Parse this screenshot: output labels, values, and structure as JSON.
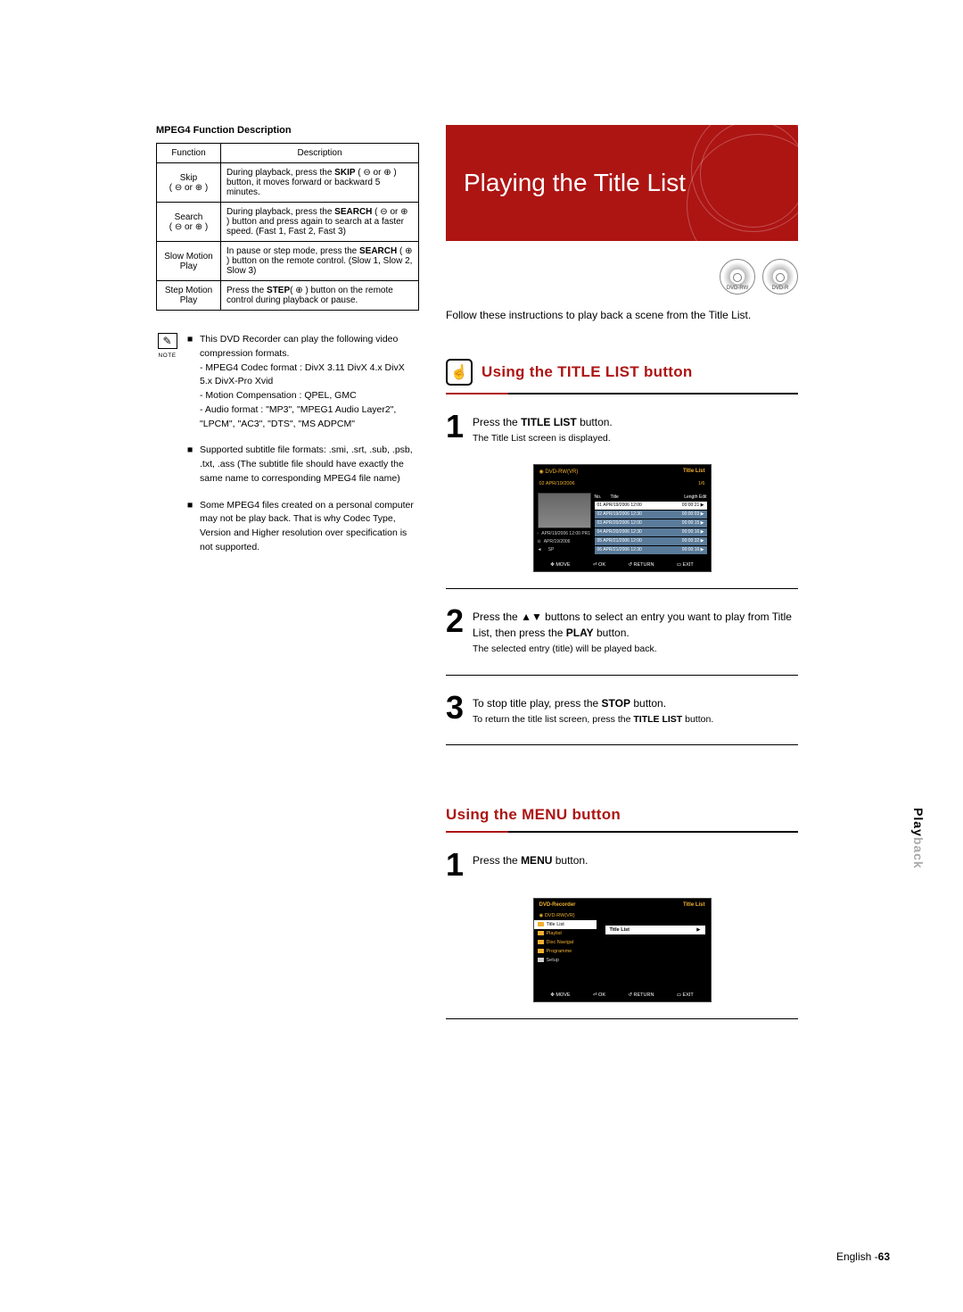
{
  "left": {
    "table_title": "MPEG4 Function Description",
    "headers": [
      "Function",
      "Description"
    ],
    "rows": [
      {
        "func": "Skip\n( ⊖ or ⊕ )",
        "desc_pre": "During playback, press the ",
        "desc_bold": "SKIP",
        "desc_post": " ( ⊖ or ⊕ ) button, it moves forward or backward 5 minutes."
      },
      {
        "func": "Search\n( ⊖ or ⊕ )",
        "desc_pre": "During playback, press the ",
        "desc_bold": "SEARCH",
        "desc_post": " ( ⊖ or ⊕ ) button and press again to search at a faster speed. (Fast 1, Fast 2, Fast 3)"
      },
      {
        "func": "Slow Motion\nPlay",
        "desc_pre": "In pause or step mode, press the ",
        "desc_bold": "SEARCH",
        "desc_post": " ( ⊕ ) button on the remote control. (Slow 1, Slow 2, Slow 3)"
      },
      {
        "func": "Step Motion\nPlay",
        "desc_pre": "Press the ",
        "desc_bold": "STEP",
        "desc_post": "( ⊕ ) button on the remote control during playback or pause."
      }
    ],
    "note_label": "NOTE",
    "notes": [
      {
        "text": "This DVD Recorder can play the following video compression formats.",
        "sub": [
          "MPEG4 Codec format : DivX 3.11 DivX 4.x DivX 5.x DivX-Pro Xvid",
          "Motion Compensation : QPEL, GMC",
          "Audio format : \"MP3\", \"MPEG1 Audio Layer2\", \"LPCM\", \"AC3\", \"DTS\", \"MS ADPCM\""
        ]
      },
      {
        "text": "Supported subtitle file formats: .smi, .srt, .sub, .psb, .txt, .ass (The subtitle file should have exactly the same name to corresponding MPEG4 file name)"
      },
      {
        "text": "Some MPEG4 files created on a personal computer may not be play back. That is why Codec Type, Version and Higher resolution over specification is not supported."
      }
    ]
  },
  "right": {
    "hero": "Playing the Title List",
    "discs": [
      "DVD-RW",
      "DVD-R"
    ],
    "intro": "Follow these instructions to play back a scene from the Title List.",
    "section1_title": "Using the TITLE LIST button",
    "step1_main_pre": "Press the ",
    "step1_main_bold": "TITLE LIST",
    "step1_main_post": " button.",
    "step1_sub": "The Title List screen is displayed.",
    "osd1": {
      "header_left": "DVD-RW(VR)",
      "header_right": "Title List",
      "subhead_left": "02 APR/19/2006",
      "subhead_right": "1/6",
      "list_head": [
        "No.",
        "Title",
        "Length Edit"
      ],
      "rows": [
        {
          "n": "01",
          "t": "APR/19/2006 12:00",
          "l": "00:00:21 ▶"
        },
        {
          "n": "02",
          "t": "APR/19/2006 12:30",
          "l": "00:00:03 ▶"
        },
        {
          "n": "03",
          "t": "APR/20/2006 12:00",
          "l": "00:00:15 ▶"
        },
        {
          "n": "04",
          "t": "APR/20/2006 12:30",
          "l": "00:00:16 ▶"
        },
        {
          "n": "05",
          "t": "APR/21/2006 12:00",
          "l": "00:00:32 ▶"
        },
        {
          "n": "06",
          "t": "APR/21/2006 12:30",
          "l": "00:00:16 ▶"
        }
      ],
      "meta1": "APR/19/2006 12:00 PR1",
      "meta2": "APR/19/2006",
      "meta3": "SP",
      "foot": [
        "MOVE",
        "OK",
        "RETURN",
        "EXIT"
      ]
    },
    "step2_pre": "Press the ",
    "step2_mid": "▲▼",
    "step2_post": " buttons to select an entry you want to play from Title List, then press the ",
    "step2_bold": "PLAY",
    "step2_after": " button.",
    "step2_sub": "The selected entry (title) will be played back.",
    "step3_pre": "To stop title play, press the ",
    "step3_bold": "STOP",
    "step3_post": " button.",
    "step3_sub_pre": "To return the title list screen, press the ",
    "step3_sub_bold": "TITLE LIST",
    "step3_sub_post": " button.",
    "section2_title": "Using the MENU button",
    "step1b_pre": "Press the ",
    "step1b_bold": "MENU",
    "step1b_post": " button.",
    "osd2": {
      "header_left": "DVD-Recorder",
      "header_right": "Title List",
      "sub": "DVD-RW(VR)",
      "menu": [
        "Title List",
        "Playlist",
        "Disc Navigat",
        "Programme",
        "Setup"
      ],
      "main_label": "Title List",
      "foot": [
        "MOVE",
        "OK",
        "RETURN",
        "EXIT"
      ]
    }
  },
  "side_label_top": "Play",
  "side_label_bottom": "back",
  "footer_pre": "English -",
  "footer_num": "63"
}
